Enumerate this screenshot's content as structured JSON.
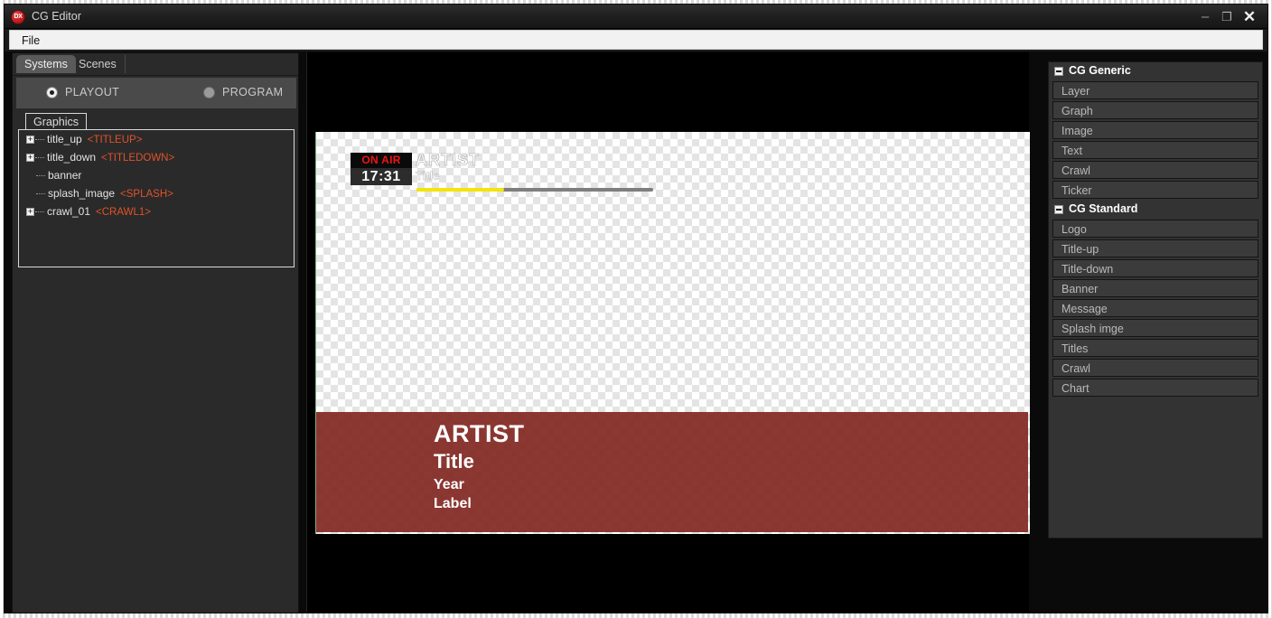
{
  "window": {
    "title": "CG Editor",
    "app_icon": "DX",
    "minimize_icon": "–",
    "maximize_icon": "❐",
    "close_icon": "✕"
  },
  "menu": {
    "items": [
      {
        "label": "File"
      }
    ]
  },
  "left_panel": {
    "tabs": [
      {
        "label": "Systems",
        "active": true
      },
      {
        "label": "Scenes",
        "active": false
      }
    ],
    "mode_radios": [
      {
        "label": "PLAYOUT",
        "selected": true
      },
      {
        "label": "PROGRAM",
        "selected": false
      }
    ],
    "tree_tab": {
      "label": "Graphics"
    },
    "tree_items": [
      {
        "name": "title_up",
        "tag": "<TITLEUP>",
        "expandable": true,
        "expand_glyph": "+"
      },
      {
        "name": "title_down",
        "tag": "<TITLEDOWN>",
        "expandable": true,
        "expand_glyph": "+"
      },
      {
        "name": "banner",
        "tag": "",
        "expandable": false,
        "expand_glyph": ""
      },
      {
        "name": "splash_image",
        "tag": "<SPLASH>",
        "expandable": false,
        "expand_glyph": ""
      },
      {
        "name": "crawl_01",
        "tag": "<CRAWL1>",
        "expandable": true,
        "expand_glyph": "+"
      }
    ]
  },
  "preview": {
    "on_air_label": "ON AIR",
    "clock": "17:31",
    "ghost_artist": "ARTIST",
    "ghost_title": "Title",
    "progress_percent": 37,
    "banner": {
      "artist": "ARTIST",
      "title": "Title",
      "year": "Year",
      "label": "Label",
      "background_color": "#80221c"
    },
    "colors": {
      "on_air_text": "#f21414",
      "clock_text": "#fafafa",
      "progress_fill": "#f3e40a",
      "progress_track": "#7e7e7e"
    }
  },
  "right_panel": {
    "groups": [
      {
        "header": "CG Generic",
        "collapse_glyph": "−",
        "items": [
          {
            "label": "Layer"
          },
          {
            "label": "Graph"
          },
          {
            "label": "Image"
          },
          {
            "label": "Text"
          },
          {
            "label": "Crawl"
          },
          {
            "label": "Ticker"
          }
        ]
      },
      {
        "header": "CG Standard",
        "collapse_glyph": "−",
        "items": [
          {
            "label": "Logo"
          },
          {
            "label": "Title-up"
          },
          {
            "label": "Title-down"
          },
          {
            "label": "Banner"
          },
          {
            "label": "Message"
          },
          {
            "label": "Splash imge"
          },
          {
            "label": "Titles"
          },
          {
            "label": "Crawl"
          },
          {
            "label": "Chart"
          }
        ]
      }
    ]
  }
}
